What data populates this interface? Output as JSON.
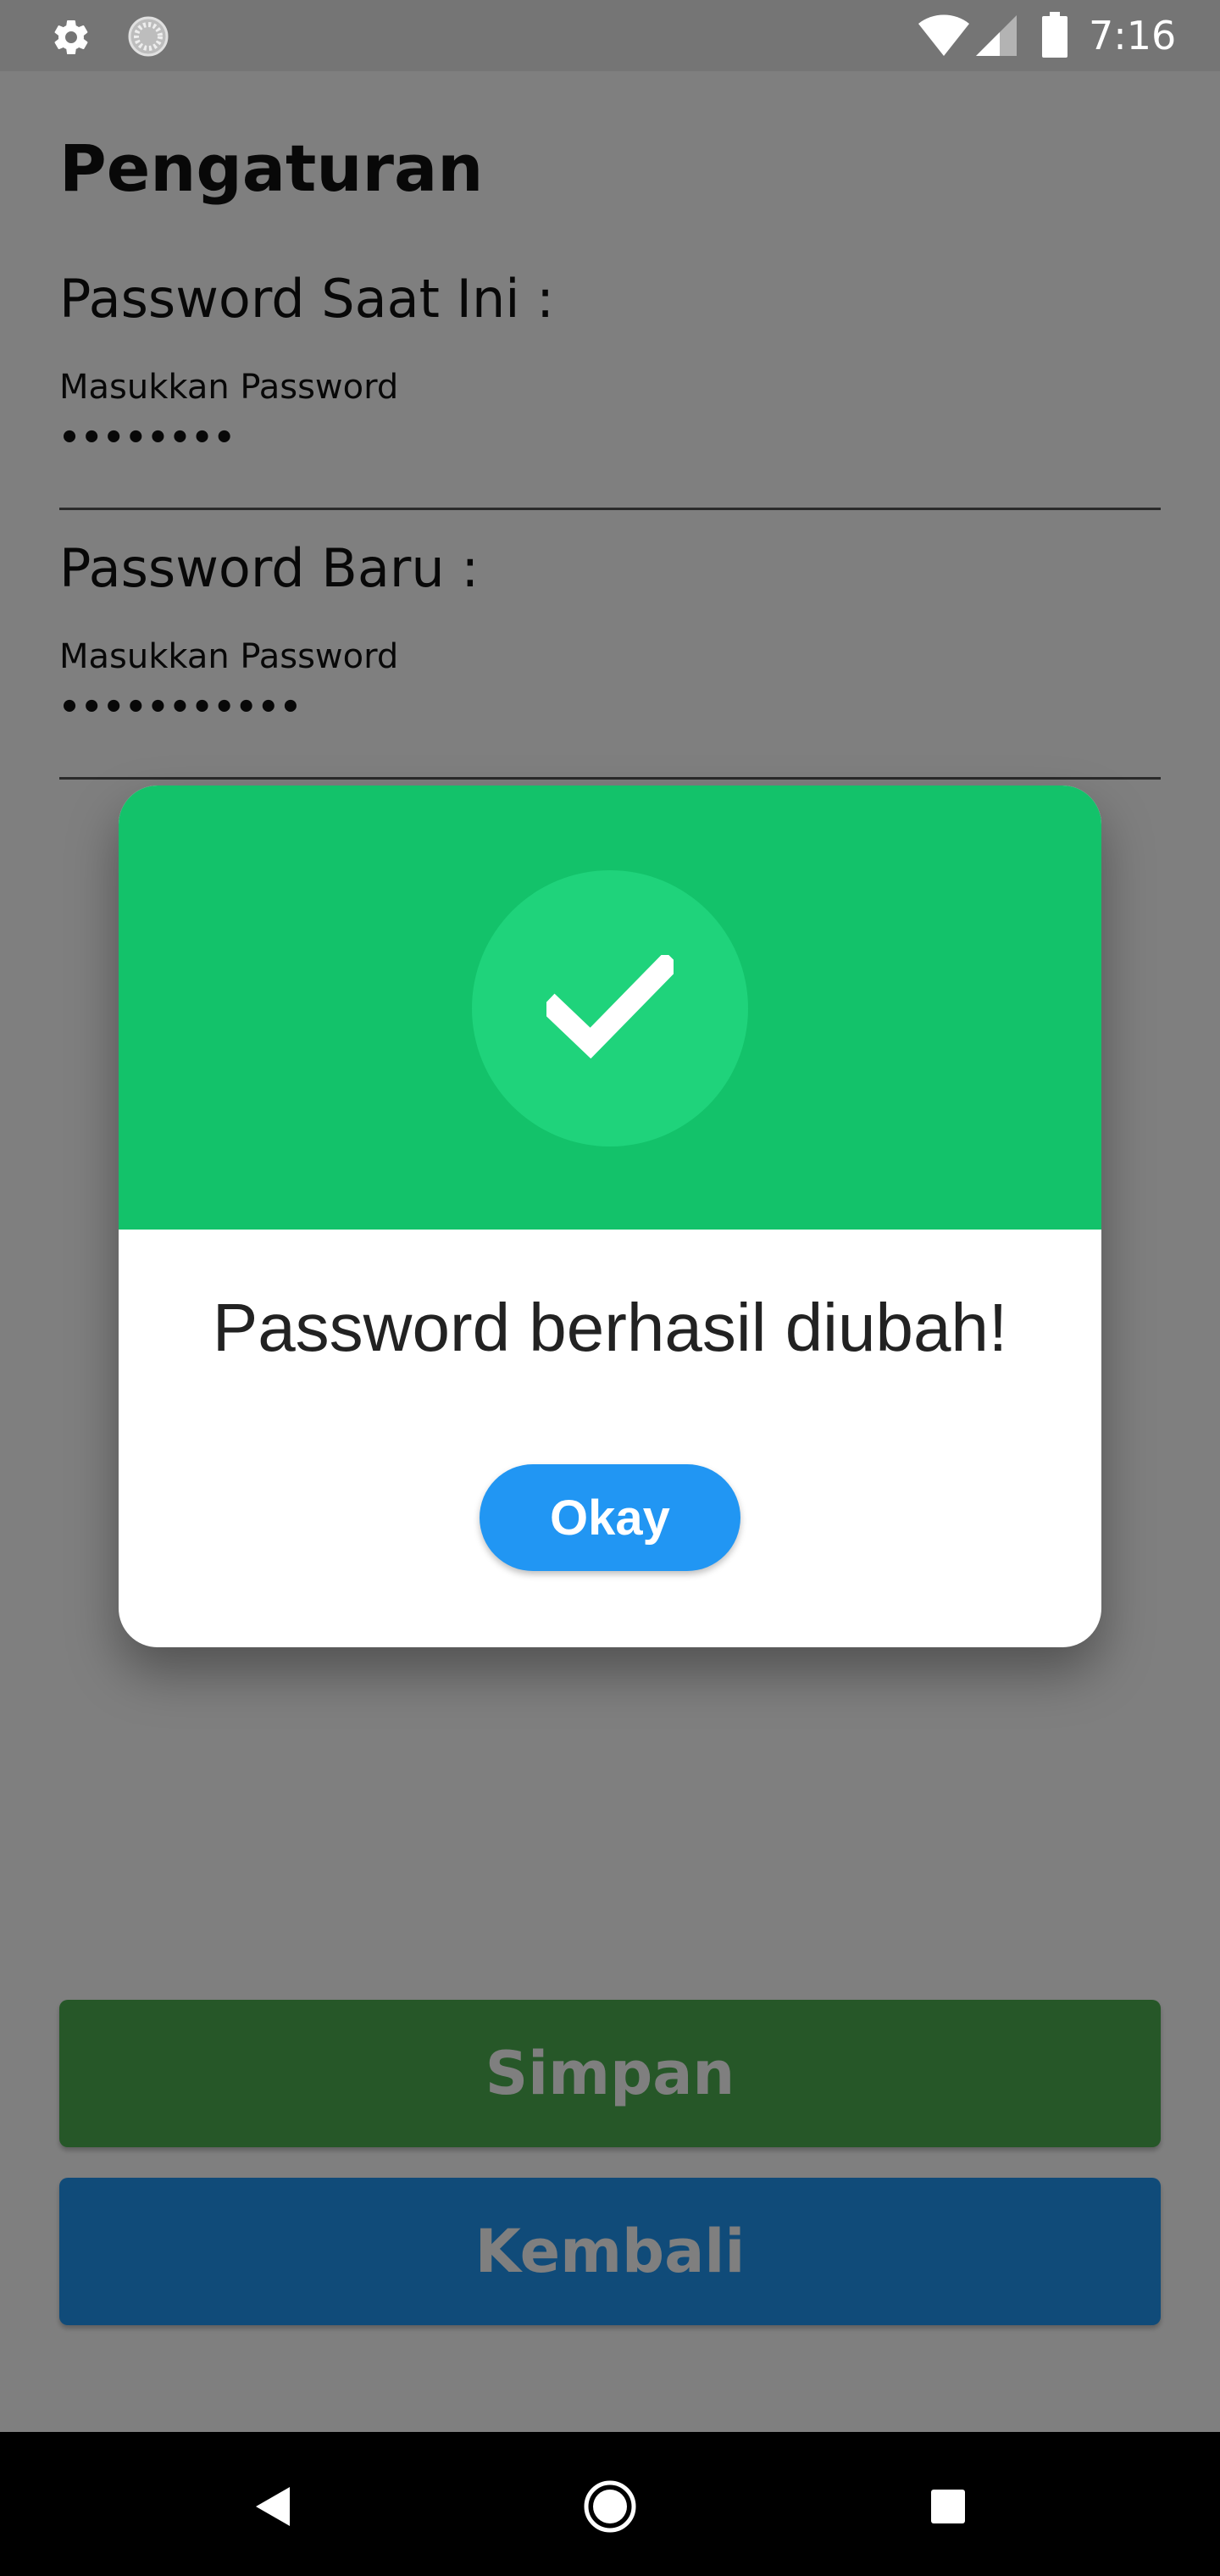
{
  "status_bar": {
    "time": "7:16",
    "icons": [
      "gear-icon",
      "loading-icon",
      "wifi-icon",
      "signal-icon",
      "battery-icon"
    ]
  },
  "page": {
    "title": "Pengaturan",
    "current_password": {
      "label": "Password Saat Ini :",
      "hint": "Masukkan Password",
      "value": "••••••••"
    },
    "new_password": {
      "label": "Password Baru :",
      "hint": "Masukkan Password",
      "value": "•••••••••••"
    },
    "save_button": "Simpan",
    "back_button": "Kembali"
  },
  "dialog": {
    "icon": "checkmark-icon",
    "message": "Password berhasil diubah!",
    "ok_button": "Okay"
  },
  "colors": {
    "dialog_header": "#13c26a",
    "dialog_circle": "#1fd37b",
    "okay_button": "#2196f3",
    "save_button": "#4caf50",
    "back_button": "#2196f3"
  },
  "nav_bar": {
    "icons": [
      "back-icon",
      "home-icon",
      "recents-icon"
    ]
  }
}
